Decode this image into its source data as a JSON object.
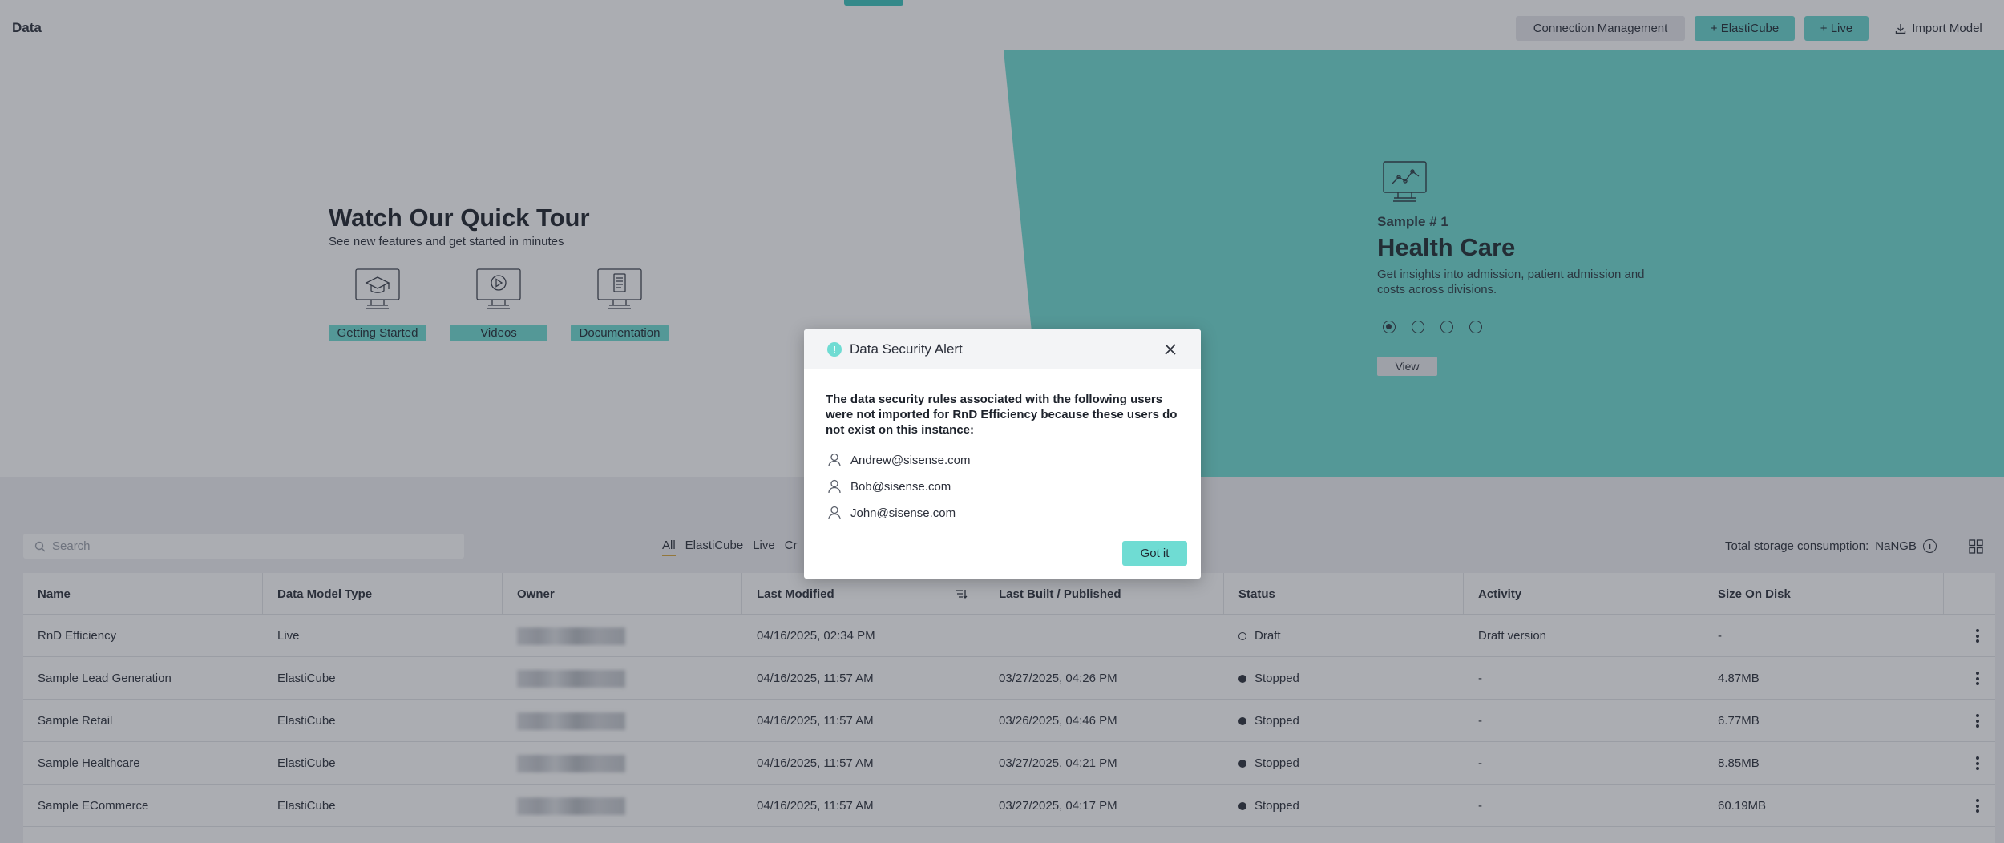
{
  "header": {
    "title": "Data",
    "buttons": {
      "connection": "Connection Management",
      "elasticube": "+ ElastiCube",
      "live": "+ Live",
      "import": "Import Model"
    }
  },
  "hero": {
    "tour_title": "Watch Our Quick Tour",
    "tour_sub": "See new features and get started in minutes",
    "tour_items": [
      "Getting Started",
      "Videos",
      "Documentation"
    ],
    "sample": {
      "number": "Sample # 1",
      "title": "Health Care",
      "description": "Get insights into admission, patient admission and costs across divisions.",
      "view_label": "View"
    }
  },
  "toolbar": {
    "search_placeholder": "Search",
    "filters": [
      "All",
      "ElastiCube",
      "Live",
      "Cr"
    ],
    "storage_label": "Total storage consumption:",
    "storage_value": "NaNGB"
  },
  "table": {
    "columns": [
      "Name",
      "Data Model Type",
      "Owner",
      "Last Modified",
      "Last Built / Published",
      "Status",
      "Activity",
      "Size On Disk"
    ],
    "rows": [
      {
        "name": "RnD Efficiency",
        "type": "Live",
        "modified": "04/16/2025, 02:34 PM",
        "built": "",
        "status": "Draft",
        "activity": "Draft version",
        "size": "-"
      },
      {
        "name": "Sample Lead Generation",
        "type": "ElastiCube",
        "modified": "04/16/2025, 11:57 AM",
        "built": "03/27/2025, 04:26 PM",
        "status": "Stopped",
        "activity": "-",
        "size": "4.87MB"
      },
      {
        "name": "Sample Retail",
        "type": "ElastiCube",
        "modified": "04/16/2025, 11:57 AM",
        "built": "03/26/2025, 04:46 PM",
        "status": "Stopped",
        "activity": "-",
        "size": "6.77MB"
      },
      {
        "name": "Sample Healthcare",
        "type": "ElastiCube",
        "modified": "04/16/2025, 11:57 AM",
        "built": "03/27/2025, 04:21 PM",
        "status": "Stopped",
        "activity": "-",
        "size": "8.85MB"
      },
      {
        "name": "Sample ECommerce",
        "type": "ElastiCube",
        "modified": "04/16/2025, 11:57 AM",
        "built": "03/27/2025, 04:17 PM",
        "status": "Stopped",
        "activity": "-",
        "size": "60.19MB"
      }
    ]
  },
  "dialog": {
    "title": "Data Security Alert",
    "message": "The data security rules associated with the following users were not imported for RnD Efficiency because these users do not exist on this instance:",
    "users": [
      "Andrew@sisense.com",
      "Bob@sisense.com",
      "John@sisense.com"
    ],
    "confirm": "Got it"
  },
  "colors": {
    "accent": "#6fdcd3",
    "overlay": "#2e323e",
    "active_filter": "#d8a53a"
  }
}
